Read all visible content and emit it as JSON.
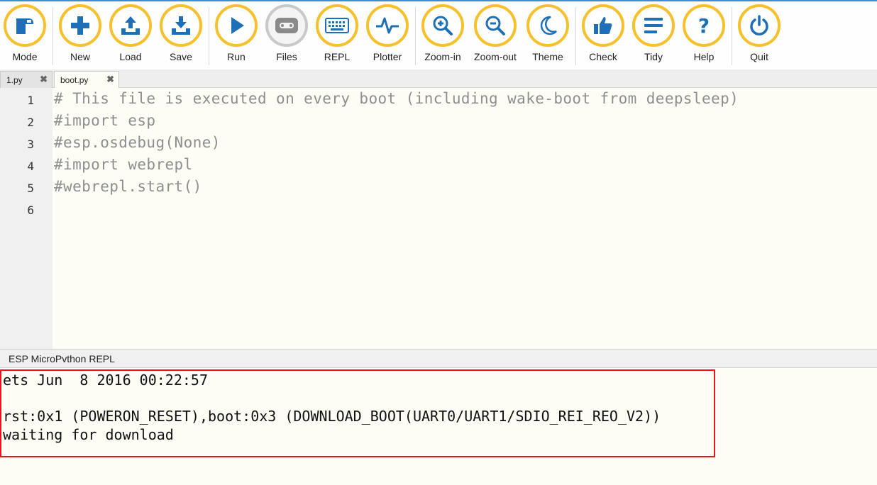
{
  "toolbar": {
    "buttons": [
      {
        "label": "Mode",
        "icon": "mode-icon"
      },
      {
        "label": "New",
        "icon": "plus-icon"
      },
      {
        "label": "Load",
        "icon": "upload-icon"
      },
      {
        "label": "Save",
        "icon": "download-icon"
      },
      {
        "label": "Run",
        "icon": "play-icon"
      },
      {
        "label": "Files",
        "icon": "files-icon"
      },
      {
        "label": "REPL",
        "icon": "keyboard-icon"
      },
      {
        "label": "Plotter",
        "icon": "pulse-icon"
      },
      {
        "label": "Zoom-in",
        "icon": "zoom-in-icon"
      },
      {
        "label": "Zoom-out",
        "icon": "zoom-out-icon"
      },
      {
        "label": "Theme",
        "icon": "moon-icon"
      },
      {
        "label": "Check",
        "icon": "thumbs-up-icon"
      },
      {
        "label": "Tidy",
        "icon": "lines-icon"
      },
      {
        "label": "Help",
        "icon": "question-icon"
      },
      {
        "label": "Quit",
        "icon": "power-icon"
      }
    ],
    "accent_color": "#f7c02d",
    "icon_color": "#1e6fb8"
  },
  "tabs": [
    {
      "label": "1.py",
      "close": "✖"
    },
    {
      "label": "boot.py",
      "close": "✖"
    }
  ],
  "editor": {
    "line_numbers": [
      "1",
      "2",
      "3",
      "4",
      "5",
      "6"
    ],
    "lines": [
      "# This file is executed on every boot (including wake-boot from deepsleep)",
      "#import esp",
      "#esp.osdebug(None)",
      "#import webrepl",
      "#webrepl.start()",
      ""
    ]
  },
  "repl": {
    "title": "ESP MicroPvthon REPL",
    "lines": [
      "ets Jun  8 2016 00:22:57",
      "",
      "rst:0x1 (POWERON_RESET),boot:0x3 (DOWNLOAD_BOOT(UART0/UART1/SDIO_REI_REO_V2))",
      "waiting for download"
    ],
    "highlight_color": "#e8131b"
  }
}
